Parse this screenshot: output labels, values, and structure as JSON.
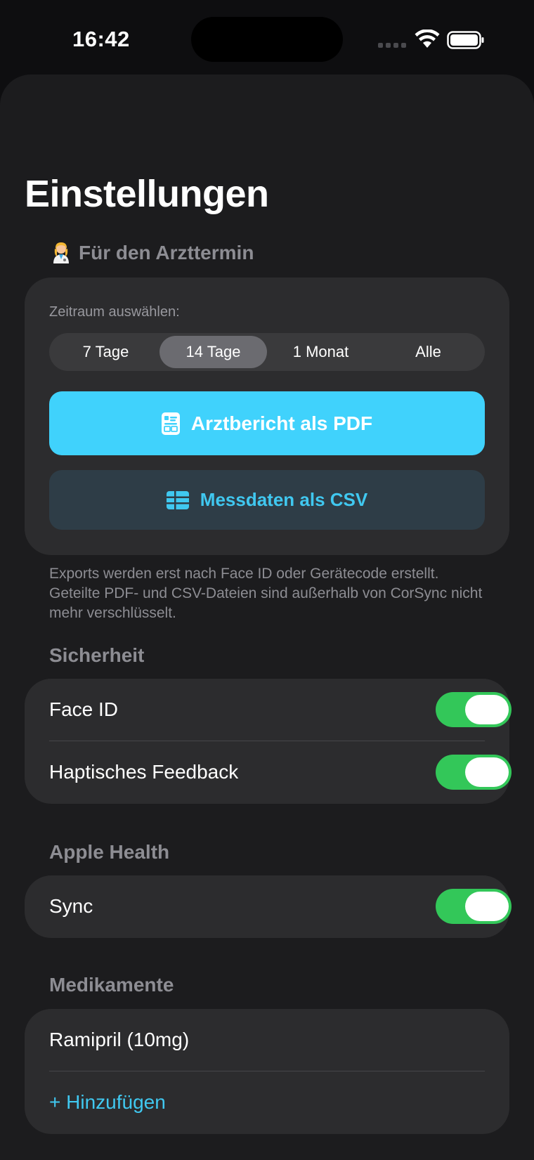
{
  "status_bar": {
    "time": "16:42"
  },
  "page": {
    "title": "Einstellungen"
  },
  "doctor_section": {
    "header_emoji": "health-worker-emoji",
    "header": "Für den Arzttermin",
    "range_label": "Zeitraum auswählen:",
    "ranges": [
      "7 Tage",
      "14 Tage",
      "1 Monat",
      "Alle"
    ],
    "selected_range": "14 Tage",
    "pdf_button": "Arztbericht als PDF",
    "pdf_icon": "document-icon",
    "csv_button": "Messdaten als CSV",
    "csv_icon": "table-icon",
    "footnote": "Exports werden erst nach Face ID oder Gerätecode erstellt. Geteilte PDF- und CSV-Dateien sind außerhalb von CorSync nicht mehr verschlüsselt."
  },
  "security": {
    "header": "Sicherheit",
    "items": [
      {
        "label": "Face ID",
        "on": true
      },
      {
        "label": "Haptisches Feedback",
        "on": true
      }
    ]
  },
  "health": {
    "header": "Apple Health",
    "items": [
      {
        "label": "Sync",
        "on": true
      }
    ]
  },
  "medications": {
    "header": "Medikamente",
    "items": [
      "Ramipril (10mg)"
    ],
    "add_label": "+ Hinzufügen"
  },
  "colors": {
    "accent": "#40d2fc",
    "toggle_on": "#33c759",
    "card": "#2c2c2e",
    "background": "#1c1c1e"
  }
}
